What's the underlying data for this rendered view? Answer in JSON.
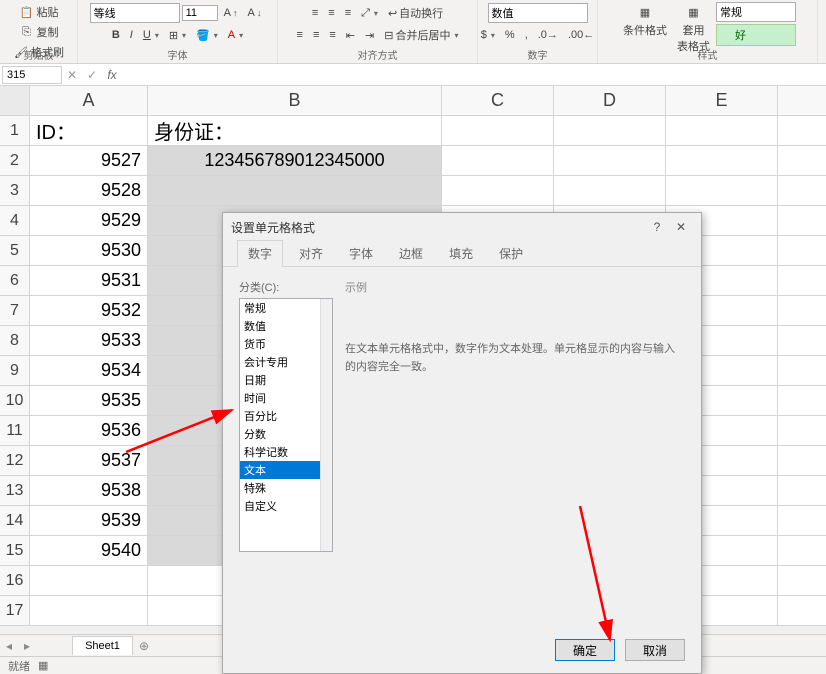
{
  "ribbon": {
    "paste_label": "粘贴",
    "copy_label": "复制",
    "format_painter": "格式刷",
    "clipboard_group": "剪贴板",
    "font_family": "等线",
    "font_size": "11",
    "font_group": "字体",
    "wrap_text": "自动换行",
    "merge_center": "合并后居中",
    "align_group": "对齐方式",
    "number_format": "数值",
    "number_group": "数字",
    "cond_format": "条件格式",
    "table_format": "套用\n表格式",
    "good_style": "好",
    "normal_style": "常规",
    "styles_group": "样式"
  },
  "formula_bar": {
    "name_box": "315",
    "fx": "fx"
  },
  "columns": [
    "A",
    "B",
    "C",
    "D",
    "E"
  ],
  "rows": [
    {
      "n": "1",
      "A": "ID：",
      "B": "身份证："
    },
    {
      "n": "2",
      "A": "9527",
      "B": "123456789012345000"
    },
    {
      "n": "3",
      "A": "9528",
      "B": ""
    },
    {
      "n": "4",
      "A": "9529",
      "B": ""
    },
    {
      "n": "5",
      "A": "9530",
      "B": ""
    },
    {
      "n": "6",
      "A": "9531",
      "B": ""
    },
    {
      "n": "7",
      "A": "9532",
      "B": ""
    },
    {
      "n": "8",
      "A": "9533",
      "B": ""
    },
    {
      "n": "9",
      "A": "9534",
      "B": ""
    },
    {
      "n": "10",
      "A": "9535",
      "B": ""
    },
    {
      "n": "11",
      "A": "9536",
      "B": ""
    },
    {
      "n": "12",
      "A": "9537",
      "B": ""
    },
    {
      "n": "13",
      "A": "9538",
      "B": ""
    },
    {
      "n": "14",
      "A": "9539",
      "B": ""
    },
    {
      "n": "15",
      "A": "9540",
      "B": ""
    },
    {
      "n": "16",
      "A": "",
      "B": ""
    },
    {
      "n": "17",
      "A": "",
      "B": ""
    }
  ],
  "sheet_tab": "Sheet1",
  "status": "就绪",
  "dialog": {
    "title": "设置单元格格式",
    "help": "?",
    "tabs": [
      "数字",
      "对齐",
      "字体",
      "边框",
      "填充",
      "保护"
    ],
    "cat_label": "分类(C):",
    "categories": [
      "常规",
      "数值",
      "货币",
      "会计专用",
      "日期",
      "时间",
      "百分比",
      "分数",
      "科学记数",
      "文本",
      "特殊",
      "自定义"
    ],
    "selected_cat": "文本",
    "sample_label": "示例",
    "desc": "在文本单元格格式中，数字作为文本处理。单元格显示的内容与输入的内容完全一致。",
    "ok": "确定",
    "cancel": "取消"
  }
}
